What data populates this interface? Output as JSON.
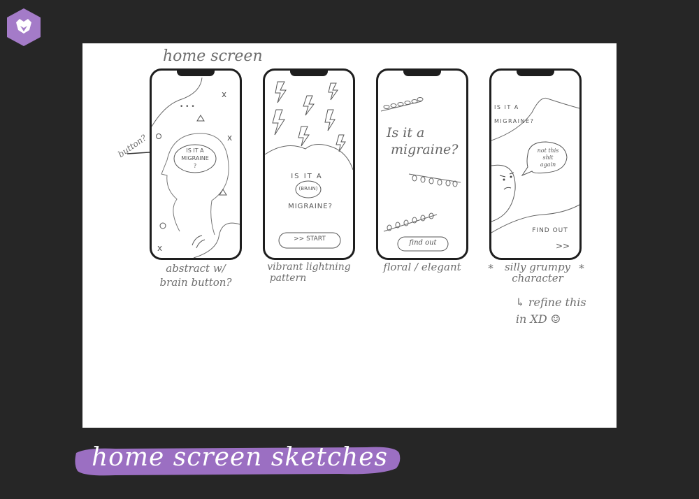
{
  "heading": "home screen",
  "annotation_button": "button?",
  "phones": [
    {
      "text_lines": [
        "IS IT A",
        "MIGRAINE",
        "?"
      ],
      "caption": [
        "abstract w/",
        "brain button?"
      ]
    },
    {
      "text_lines": [
        "IS IT A",
        "(BRAIN)",
        "MIGRAINE?"
      ],
      "button": ">> START",
      "caption": [
        "vibrant lightning",
        "pattern"
      ]
    },
    {
      "text_lines": [
        "Is it a",
        "migraine?"
      ],
      "button": "find out",
      "caption": [
        "floral / elegant"
      ]
    },
    {
      "text_lines": [
        "IS IT A",
        "MIGRAINE?"
      ],
      "bubble": [
        "not this",
        "shit",
        "again"
      ],
      "action": "FIND OUT",
      "chevrons": ">>",
      "caption": [
        "silly grumpy",
        "character"
      ],
      "star": "*"
    }
  ],
  "note": [
    "↳ refine this",
    "in XD ☺"
  ],
  "banner_text": "home screen sketches",
  "colors": {
    "background": "#262626",
    "paper": "#ffffff",
    "logo": "#a47bc8",
    "banner": "#9b6fc2"
  },
  "icons": {
    "logo": "hexagon-fox-logo"
  }
}
